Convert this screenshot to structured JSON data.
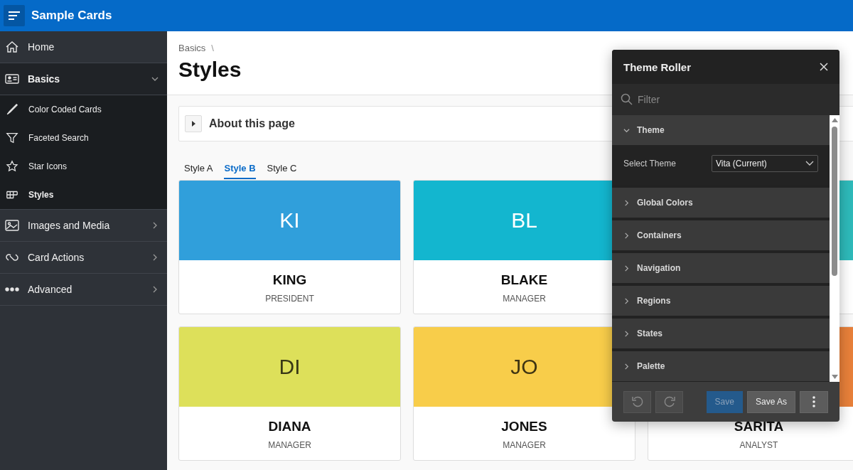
{
  "header": {
    "title": "Sample Cards"
  },
  "sidebar": {
    "items": [
      {
        "label": "Home"
      },
      {
        "label": "Basics",
        "expanded": true,
        "children": [
          {
            "label": "Color Coded Cards",
            "selected": false
          },
          {
            "label": "Faceted Search",
            "selected": false
          },
          {
            "label": "Star Icons",
            "selected": false
          },
          {
            "label": "Styles",
            "selected": true
          }
        ]
      },
      {
        "label": "Images and Media",
        "expanded": false
      },
      {
        "label": "Card Actions",
        "expanded": false
      },
      {
        "label": "Advanced",
        "expanded": false
      }
    ]
  },
  "breadcrumb": [
    {
      "label": "Basics",
      "separator": "\\"
    }
  ],
  "page_title": "Styles",
  "about": {
    "label": "About this page",
    "expanded": false
  },
  "tabs": [
    {
      "label": "Style A",
      "selected": false
    },
    {
      "label": "Style B",
      "selected": true
    },
    {
      "label": "Style C",
      "selected": false
    }
  ],
  "cards": [
    {
      "initials": "KI",
      "name": "KING",
      "job": "PRESIDENT",
      "color": "#309fdb"
    },
    {
      "initials": "BL",
      "name": "BLAKE",
      "job": "MANAGER",
      "color": "#13b6cf"
    },
    {
      "color": "#2ebaba"
    },
    {
      "initials": "DI",
      "name": "DIANA",
      "job": "MANAGER",
      "color": "#dde05a"
    },
    {
      "initials": "JO",
      "name": "JONES",
      "job": "MANAGER",
      "color": "#f8cd4a"
    },
    {
      "name": "SARITA",
      "job": "ANALYST",
      "color": "#e8803a"
    }
  ],
  "theme_roller": {
    "title": "Theme Roller",
    "filter": {
      "placeholder": "Filter"
    },
    "sections": [
      {
        "label": "Theme",
        "expanded": true,
        "fields": [
          {
            "label": "Select Theme",
            "value": "Vita (Current)"
          }
        ]
      },
      {
        "label": "Global Colors",
        "expanded": false
      },
      {
        "label": "Containers",
        "expanded": false
      },
      {
        "label": "Navigation",
        "expanded": false
      },
      {
        "label": "Regions",
        "expanded": false
      },
      {
        "label": "States",
        "expanded": false
      },
      {
        "label": "Palette",
        "expanded": false
      }
    ],
    "buttons": [
      {
        "label": "Save",
        "kind": "primary",
        "disabled": true
      },
      {
        "label": "Save As",
        "kind": "normal",
        "disabled": false
      }
    ]
  }
}
